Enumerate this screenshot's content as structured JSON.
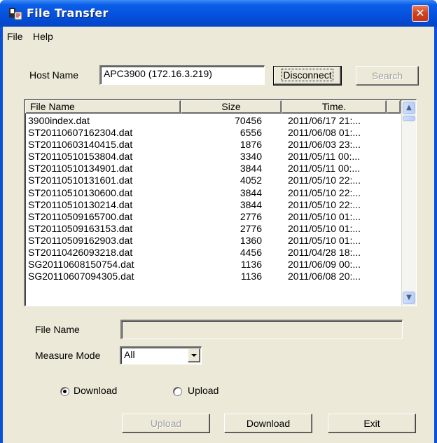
{
  "window": {
    "title": "File Transfer",
    "close_glyph": "✕"
  },
  "menu": {
    "items": [
      "File",
      "Help"
    ]
  },
  "host": {
    "label": "Host Name",
    "value": "APC3900 (172.16.3.219)",
    "disconnect_label": "Disconnect",
    "search_label": "Search"
  },
  "list": {
    "columns": [
      "File Name",
      "Size",
      "Time."
    ],
    "rows": [
      {
        "name": "3900index.dat",
        "size": "70456",
        "time": "2011/06/17 21:..."
      },
      {
        "name": "ST20110607162304.dat",
        "size": "6556",
        "time": "2011/06/08 01:..."
      },
      {
        "name": "ST20110603140415.dat",
        "size": "1876",
        "time": "2011/06/03 23:..."
      },
      {
        "name": "ST20110510153804.dat",
        "size": "3340",
        "time": "2011/05/11 00:..."
      },
      {
        "name": "ST20110510134901.dat",
        "size": "3844",
        "time": "2011/05/11 00:..."
      },
      {
        "name": "ST20110510131601.dat",
        "size": "4052",
        "time": "2011/05/10 22:..."
      },
      {
        "name": "ST20110510130600.dat",
        "size": "3844",
        "time": "2011/05/10 22:..."
      },
      {
        "name": "ST20110510130214.dat",
        "size": "3844",
        "time": "2011/05/10 22:..."
      },
      {
        "name": "ST20110509165700.dat",
        "size": "2776",
        "time": "2011/05/10 01:..."
      },
      {
        "name": "ST20110509163153.dat",
        "size": "2776",
        "time": "2011/05/10 01:..."
      },
      {
        "name": "ST20110509162903.dat",
        "size": "1360",
        "time": "2011/05/10 01:..."
      },
      {
        "name": "ST20110426093218.dat",
        "size": "4456",
        "time": "2011/04/28 18:..."
      },
      {
        "name": "SG20110608150754.dat",
        "size": "1136",
        "time": "2011/06/09 00:..."
      },
      {
        "name": "SG20110607094305.dat",
        "size": "1136",
        "time": "2011/06/08 20:..."
      }
    ]
  },
  "file_name": {
    "label": "File Name",
    "value": ""
  },
  "measure_mode": {
    "label": "Measure Mode",
    "value": "All"
  },
  "direction": {
    "download_label": "Download",
    "upload_label": "Upload",
    "selected": "Download"
  },
  "buttons": {
    "upload": "Upload",
    "download": "Download",
    "exit": "Exit"
  },
  "colors": {
    "titlebar": "#0550dc",
    "close_button": "#d0401c",
    "dialog_face": "#ece9d8"
  },
  "icons": {
    "app": "file-transfer-icon",
    "close": "close-icon",
    "scroll_up": "chevron-up-icon",
    "scroll_down": "chevron-down-icon",
    "combo": "dropdown-arrow-icon"
  }
}
